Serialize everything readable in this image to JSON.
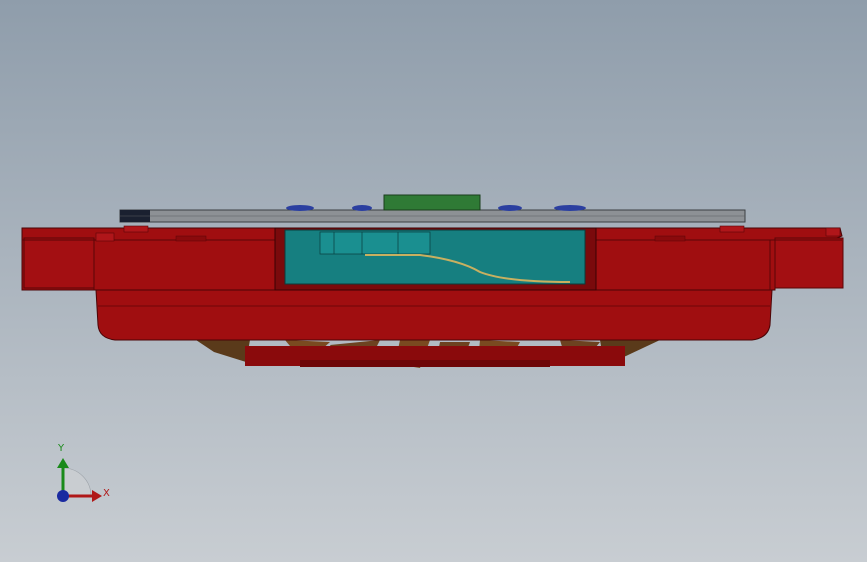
{
  "viewport": {
    "background_top": "#8f9dab",
    "background_bottom": "#c8cdd2"
  },
  "model": {
    "body_color": "#a00e10",
    "body_dark": "#6e0608",
    "cavity_color": "#167f80",
    "pcb_color": "#2f7a35",
    "plate_color": "#8d9195",
    "fan_blade_color": "#7a4a20",
    "accent_blue": "#2b3fa0"
  },
  "triad": {
    "y_label": "Y",
    "x_label": "X",
    "y_color": "#1a8a1a",
    "x_color": "#b01818",
    "z_color": "#1a2aa0"
  }
}
